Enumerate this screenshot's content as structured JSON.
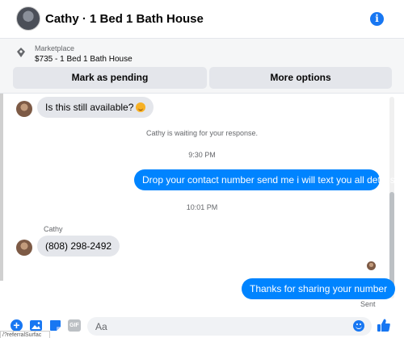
{
  "header": {
    "title": "Cathy · 1 Bed 1 Bath House",
    "info_icon": "info-icon",
    "info_glyph": "i"
  },
  "marketplace": {
    "label": "Marketplace",
    "listing": "$735 - 1 Bed 1 Bath House",
    "mark_pending_label": "Mark as pending",
    "more_options_label": "More options"
  },
  "messages": {
    "first_incoming": "Is this still available?",
    "waiting_notice": "Cathy is waiting for your response.",
    "time_1": "9:30 PM",
    "outgoing_1": "Drop your contact number send me i will text you all details",
    "time_2": "10:01 PM",
    "sender_name": "Cathy",
    "incoming_phone": "(808) 298-2492",
    "outgoing_2": "Thanks for sharing your number",
    "status": "Sent"
  },
  "composer": {
    "placeholder": "Aa",
    "plus_glyph": "+",
    "gif_label": "GIF"
  },
  "url_peek": "/?referralSurfac",
  "colors": {
    "accent": "#1877f2",
    "outgoing_bubble": "#0084ff",
    "incoming_bubble": "#e4e6eb"
  }
}
